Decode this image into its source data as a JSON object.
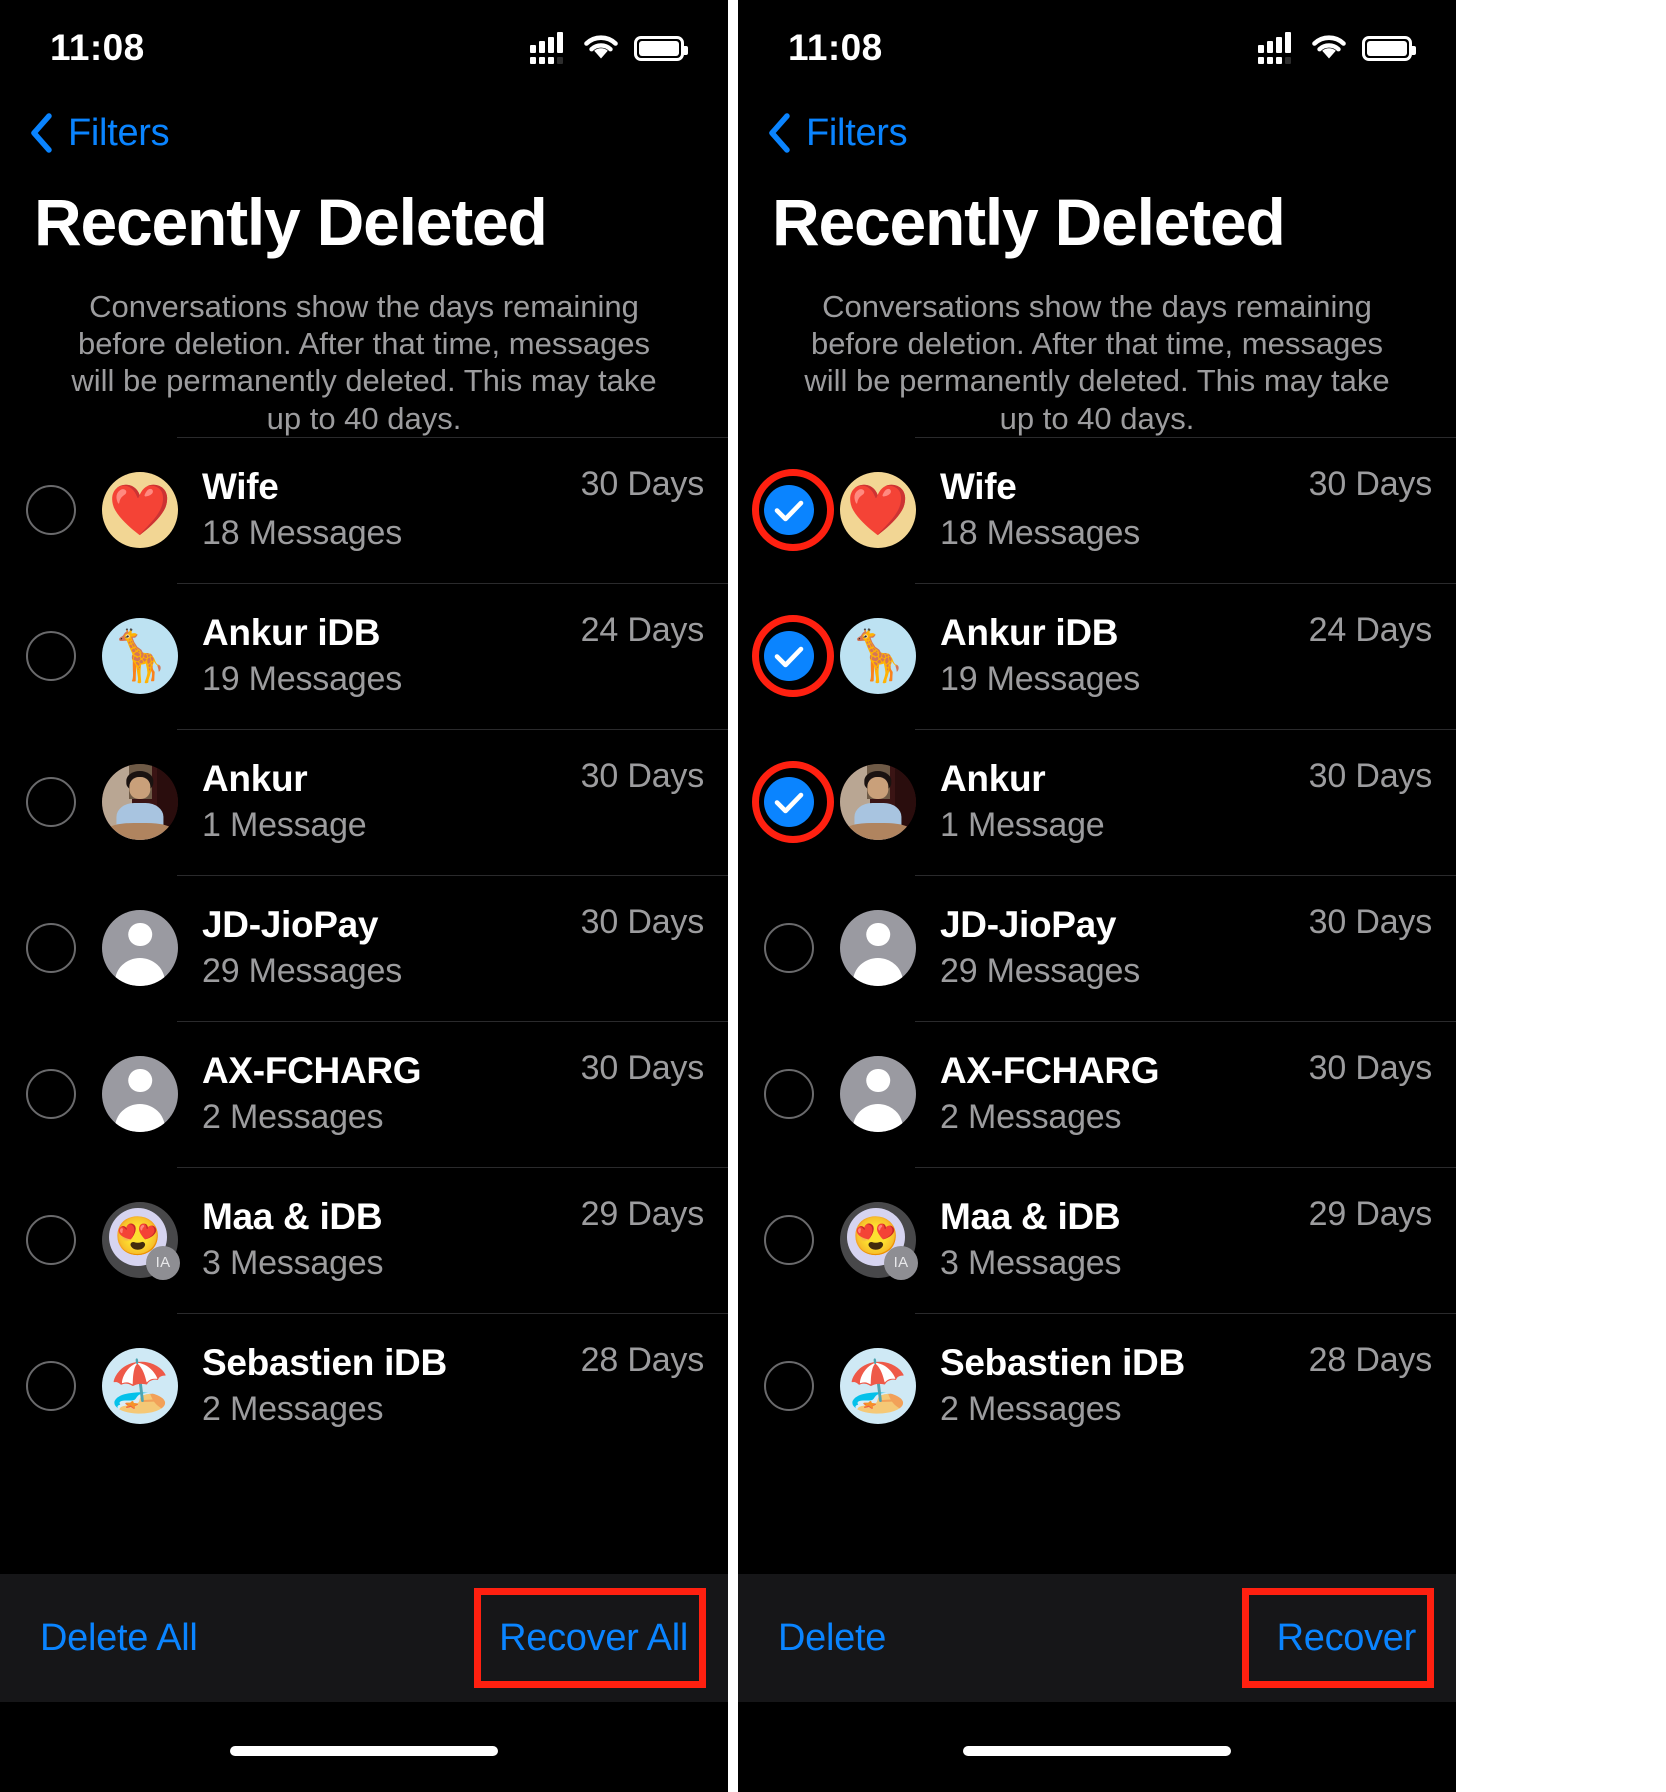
{
  "status_bar": {
    "time": "11:08",
    "icons": [
      "cellular-signal-icon",
      "wifi-icon",
      "battery-icon"
    ]
  },
  "nav": {
    "back_label": "Filters",
    "back_icon": "chevron-left-icon"
  },
  "header": {
    "title": "Recently Deleted",
    "description": "Conversations show the days remaining before deletion. After that time, messages will be permanently deleted. This may take up to 40 days."
  },
  "colors": {
    "accent_blue": "#0a84ff",
    "highlight_red": "#ff2010",
    "background": "#000000",
    "toolbar_background": "#161618",
    "secondary_text": "#9c9c9e"
  },
  "conversations": [
    {
      "name": "Wife",
      "messages": "18 Messages",
      "days": "30 Days",
      "avatar": "heart-emoji-avatar",
      "emoji": "❤️",
      "avatar_style": "emoji-yellow"
    },
    {
      "name": "Ankur iDB",
      "messages": "19 Messages",
      "days": "24 Days",
      "avatar": "giraffe-emoji-avatar",
      "emoji": "🦒",
      "avatar_style": "emoji-blue"
    },
    {
      "name": "Ankur",
      "messages": "1 Message",
      "days": "30 Days",
      "avatar": "ankur-photo-avatar",
      "emoji": "",
      "avatar_style": "photo"
    },
    {
      "name": "JD-JioPay",
      "messages": "29 Messages",
      "days": "30 Days",
      "avatar": "person-placeholder-avatar",
      "emoji": "",
      "avatar_style": "placeholder"
    },
    {
      "name": "AX-FCHARG",
      "messages": "2 Messages",
      "days": "30 Days",
      "avatar": "person-placeholder-avatar",
      "emoji": "",
      "avatar_style": "placeholder"
    },
    {
      "name": "Maa & iDB",
      "messages": "3 Messages",
      "days": "29 Days",
      "avatar": "group-heart-eyes-avatar",
      "emoji": "😍",
      "avatar_style": "group",
      "badge": "IA"
    },
    {
      "name": "Sebastien iDB",
      "messages": "2 Messages",
      "days": "28 Days",
      "avatar": "beach-emoji-avatar",
      "emoji": "🏖️",
      "avatar_style": "emoji-lblue"
    }
  ],
  "panels": [
    {
      "id": "left",
      "selection_state": "none-selected",
      "selected_indexes": [],
      "toolbar": {
        "left_label": "Delete All",
        "right_label": "Recover All",
        "highlighted_button": "Recover All"
      }
    },
    {
      "id": "right",
      "selection_state": "three-selected",
      "selected_indexes": [
        0,
        1,
        2
      ],
      "toolbar": {
        "left_label": "Delete",
        "right_label": "Recover",
        "highlighted_button": "Recover"
      }
    }
  ],
  "annotations": {
    "checkmark_icon": "checkmark-icon",
    "ring_highlight": "red-circle-highlight",
    "box_highlight": "red-box-highlight"
  }
}
